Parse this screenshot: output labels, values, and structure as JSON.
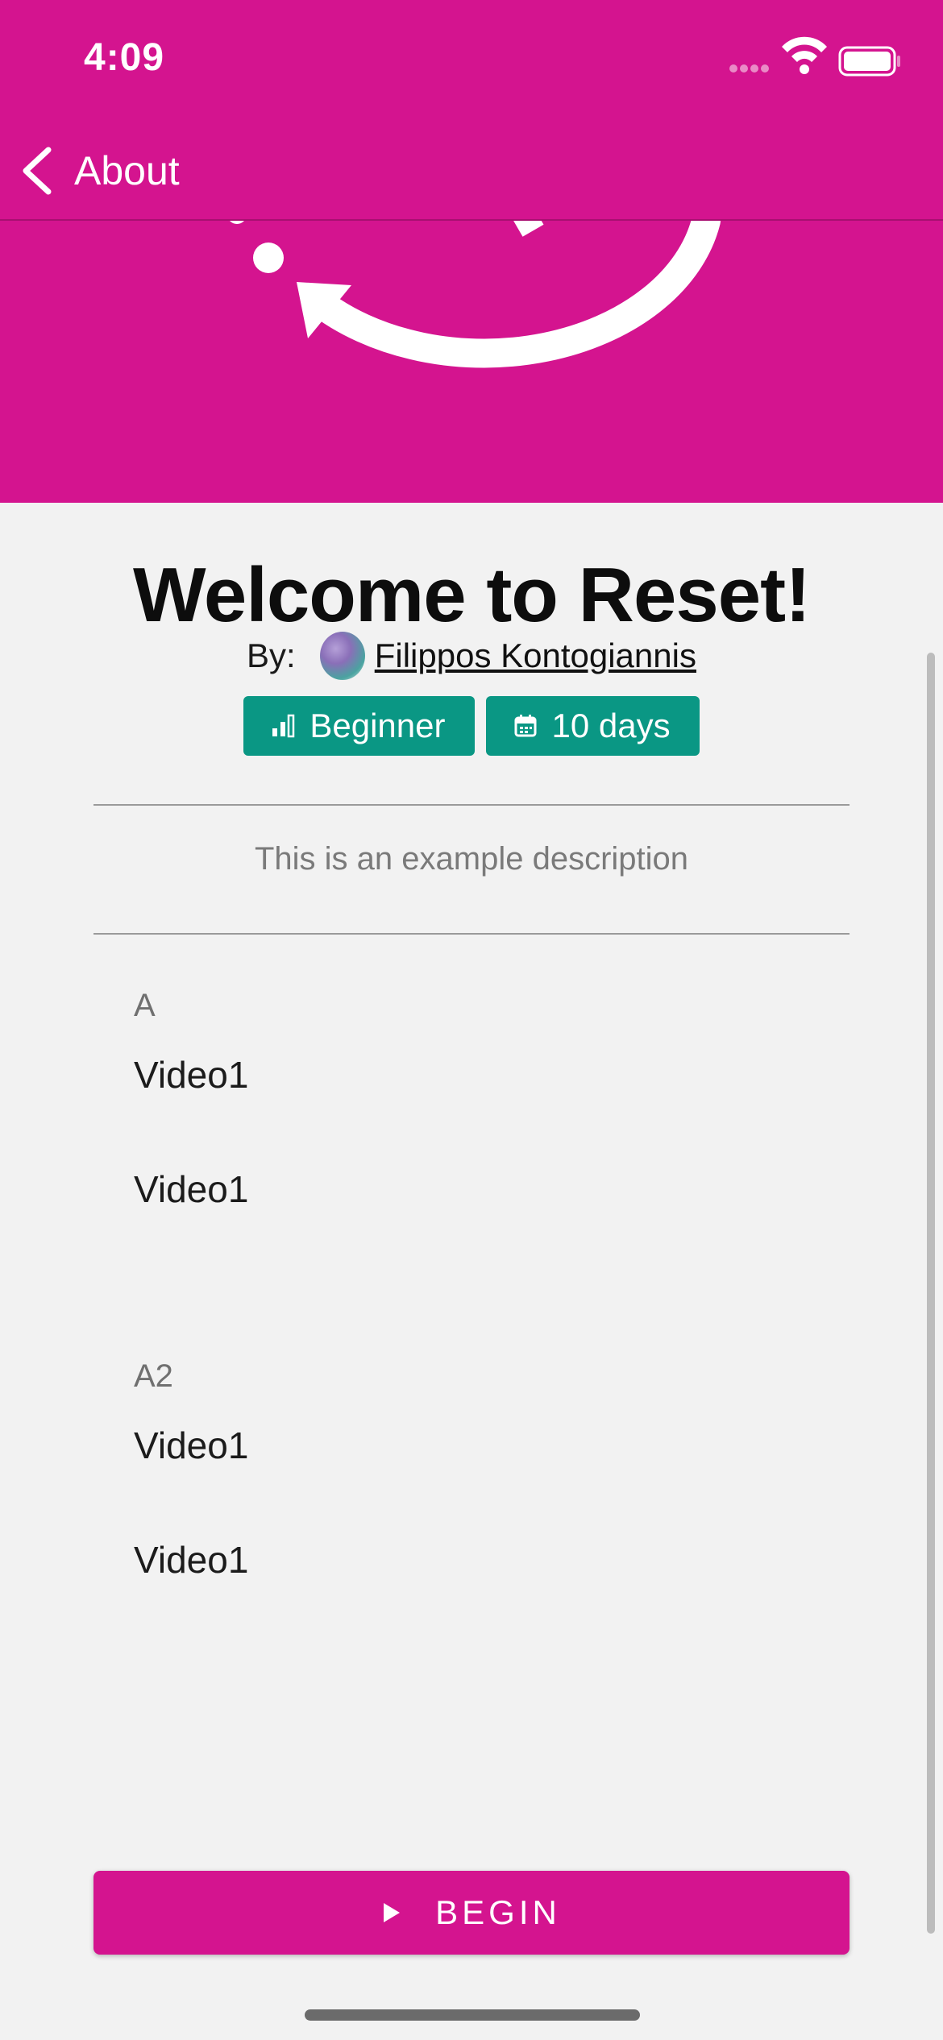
{
  "status_bar": {
    "time": "4:09"
  },
  "nav": {
    "back_label": "About"
  },
  "program": {
    "title": "Welcome to Reset!",
    "by_label": "By:",
    "author": "Filippos Kontogiannis",
    "level": "Beginner",
    "duration": "10 days",
    "description": "This is an example description"
  },
  "sections": [
    {
      "title": "A",
      "items": [
        "Video1",
        "Video1"
      ]
    },
    {
      "title": "A2",
      "items": [
        "Video1",
        "Video1"
      ]
    }
  ],
  "actions": {
    "begin_label": "BEGIN"
  },
  "colors": {
    "brand": "#d4148f",
    "tag": "#0a9784",
    "background": "#f2f2f2"
  },
  "icons": [
    "chevron-left-icon",
    "wifi-icon",
    "battery-icon",
    "signal-icon",
    "level-bars-icon",
    "calendar-icon",
    "play-icon",
    "reset-arrow-icon"
  ]
}
